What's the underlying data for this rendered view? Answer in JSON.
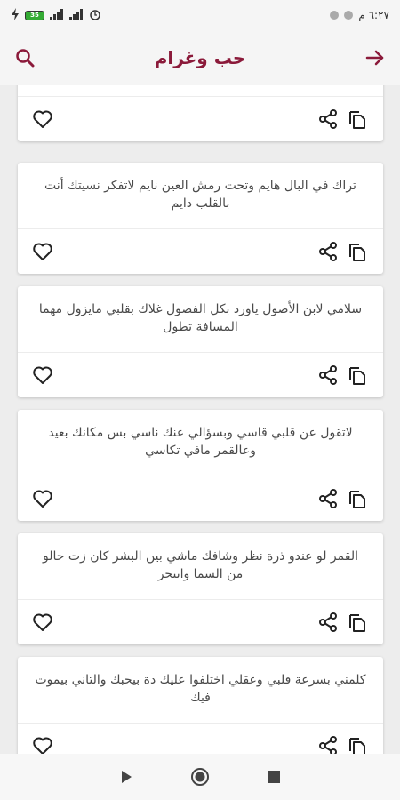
{
  "status_bar": {
    "time": "٦:٢٧ م",
    "battery": "35"
  },
  "app_bar": {
    "title": "حب وغرام"
  },
  "cards": [
    {
      "text": ""
    },
    {
      "text": "تراك في البال هايم وتحت رمش العين نايم لاتفكر نسيتك أنت بالقلب دايم"
    },
    {
      "text": "سلامي لابن الأصول ياورد بكل الفصول غلاك بقلبي مايزول مهما المسافة تطول"
    },
    {
      "text": "لاتقول عن قلبي قاسي وبسؤالي عنك ناسي بس مكانك بعيد وعالقمر مافي تكاسي"
    },
    {
      "text": "القمر لو عندو ذرة نظر وشافك ماشي بين البشر كان زت حالو من السما وانتحر"
    },
    {
      "text": "كلمني بسرعة قلبي وعقلي اختلفوا عليك دة بيحبك والتاني بيموت فيك"
    }
  ],
  "colors": {
    "accent": "#8b1a3a",
    "icon": "#222222"
  }
}
